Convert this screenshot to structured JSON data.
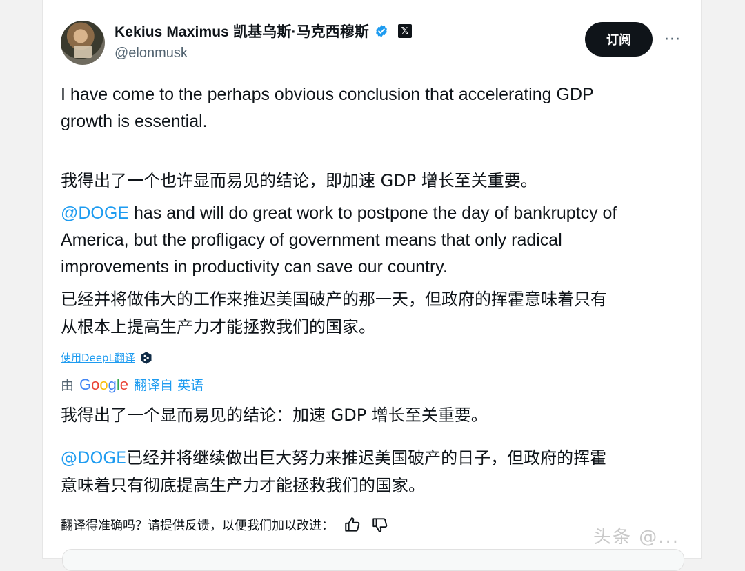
{
  "post": {
    "display_name": "Kekius Maximus 凯基乌斯·马克西穆斯",
    "handle": "@elonmusk",
    "x_logo": "𝕏",
    "subscribe_label": "订阅",
    "more_label": "···",
    "paragraph1": "I have come to the perhaps obvious conclusion that accelerating GDP\ngrowth is essential.",
    "paragraph1_cn": "我得出了一个也许显而易见的结论，即加速 GDP 增长至关重要。",
    "mention": "@DOGE",
    "paragraph2_rest": " has and will do great work to postpone the day of bankruptcy of\nAmerica, but the profligacy of government means that only radical\nimprovements in productivity can save our country.",
    "paragraph2_cn": "已经并将做伟大的工作来推迟美国破产的那一天，但政府的挥霍意味着只有\n从根本上提高生产力才能拯救我们的国家。"
  },
  "translation": {
    "deepl_link": "使用DeepL翻译",
    "by_label": "由",
    "google_letters": [
      "G",
      "o",
      "o",
      "g",
      "l",
      "e"
    ],
    "from_label": "翻译自 英语",
    "paragraph1": "我得出了一个显而易见的结论：加速 GDP 增长至关重要。",
    "mention": "@DOGE",
    "paragraph2_rest": "已经并将继续做出巨大努力来推迟美国破产的日子，但政府的挥霍\n意味着只有彻底提高生产力才能拯救我们的国家。",
    "feedback_prompt": "翻译得准确吗？请提供反馈，以便我们加以改进："
  },
  "watermark": "头条 @...",
  "icons": {
    "verified": "verified-badge-icon",
    "thumbs_up": "thumbs-up-icon",
    "thumbs_down": "thumbs-down-icon",
    "deepl": "deepl-icon"
  },
  "colors": {
    "link": "#1d9bf0",
    "text": "#0f1419",
    "muted": "#536471",
    "button_bg": "#0f1419"
  }
}
